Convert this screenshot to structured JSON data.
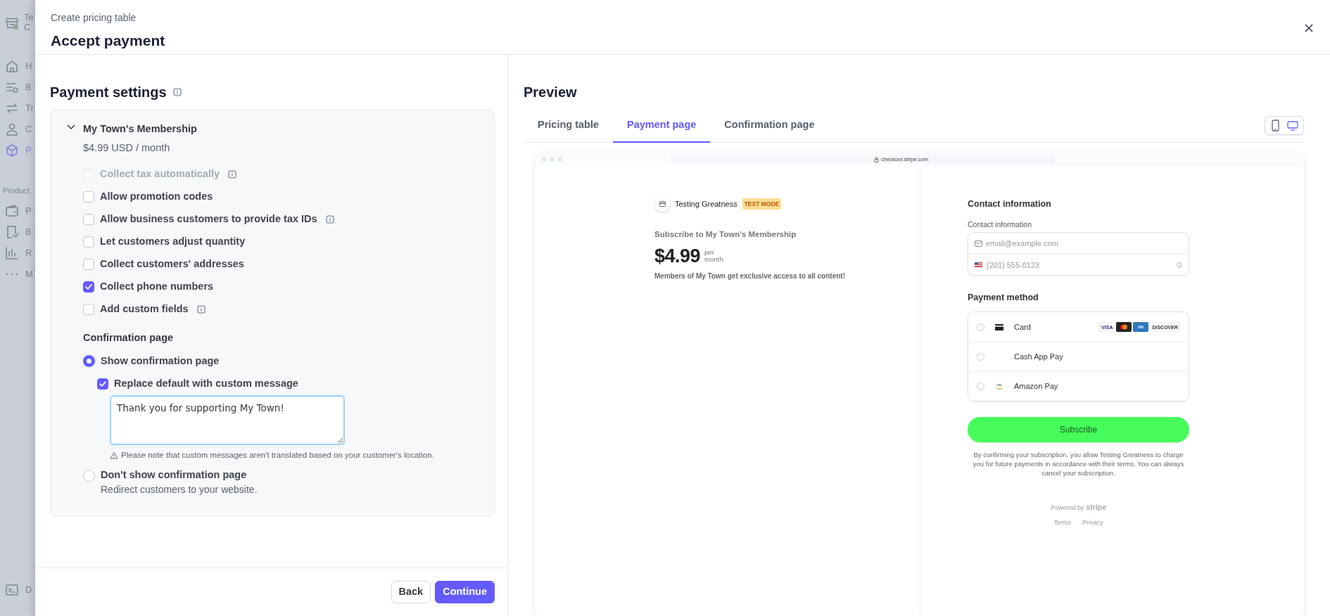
{
  "background_sidebar": {
    "account": [
      "Te",
      "C"
    ],
    "items": [
      {
        "label": "H",
        "selected": false
      },
      {
        "label": "B",
        "selected": false
      },
      {
        "label": "Tr",
        "selected": false
      },
      {
        "label": "C",
        "selected": false
      },
      {
        "label": "P",
        "selected": true
      }
    ],
    "section": "Product",
    "section_items": [
      {
        "label": "P"
      },
      {
        "label": "B"
      },
      {
        "label": "R"
      },
      {
        "label": "M"
      }
    ],
    "footer": "D"
  },
  "modal": {
    "subtitle": "Create pricing table",
    "title": "Accept payment"
  },
  "settings": {
    "title": "Payment settings",
    "product": {
      "name": "My Town's Membership",
      "price": "$4.99 USD / month",
      "expanded": true
    },
    "options": [
      {
        "label": "Collect tax automatically",
        "checked": false,
        "disabled": true,
        "info": true
      },
      {
        "label": "Allow promotion codes",
        "checked": false,
        "disabled": false,
        "info": false
      },
      {
        "label": "Allow business customers to provide tax IDs",
        "checked": false,
        "disabled": false,
        "info": true
      },
      {
        "label": "Let customers adjust quantity",
        "checked": false,
        "disabled": false,
        "info": false
      },
      {
        "label": "Collect customers' addresses",
        "checked": false,
        "disabled": false,
        "info": false
      },
      {
        "label": "Collect phone numbers",
        "checked": true,
        "disabled": false,
        "info": false
      },
      {
        "label": "Add custom fields",
        "checked": false,
        "disabled": false,
        "info": true
      }
    ],
    "confirmation": {
      "heading": "Confirmation page",
      "choices": [
        {
          "label": "Show confirmation page",
          "selected": true,
          "custom_message": {
            "label": "Replace default with custom message",
            "checked": true,
            "value": "Thank you for supporting My Town!",
            "note": "Please note that custom messages aren't translated based on your customer's location."
          }
        },
        {
          "label": "Don't show confirmation page",
          "selected": false,
          "description": "Redirect customers to your website."
        }
      ]
    }
  },
  "footer_buttons": [
    {
      "label": "Back",
      "kind": "secondary"
    },
    {
      "label": "Continue",
      "kind": "primary"
    }
  ],
  "preview": {
    "title": "Preview",
    "tabs": [
      {
        "label": "Pricing table",
        "selected": false
      },
      {
        "label": "Payment page",
        "selected": true
      },
      {
        "label": "Confirmation page",
        "selected": false
      }
    ],
    "devices": [
      {
        "kind": "phone",
        "selected": false
      },
      {
        "kind": "desktop",
        "selected": true
      }
    ],
    "checkout": {
      "url": "checkout.stripe.com",
      "merchant": "Testing Greatness",
      "badge": "TEST MODE",
      "heading": "Subscribe to My Town's Membership",
      "price": "$4.99",
      "interval": [
        "per",
        "month"
      ],
      "description": "Members of My Town get exclusive access to all content!",
      "contact": {
        "title": "Contact information",
        "label": "Contact information",
        "email_placeholder": "email@example.com",
        "phone_placeholder": "(201) 555-0123"
      },
      "payment": {
        "title": "Payment method",
        "methods": [
          {
            "label": "Card",
            "kind": "card",
            "selected": false
          },
          {
            "label": "Cash App Pay",
            "kind": "cashapp",
            "selected": false
          },
          {
            "label": "Amazon Pay",
            "kind": "amazon",
            "selected": false
          }
        ],
        "card_logos": [
          {
            "kind": "visa",
            "text": "VISA"
          },
          {
            "kind": "mastercard"
          },
          {
            "kind": "amex"
          },
          {
            "kind": "discover",
            "text": "DISCOVER"
          }
        ]
      },
      "button": "Subscribe",
      "terms": "By confirming your subscription, you allow Testing Greatness to charge you for future payments in accordance with their terms. You can always cancel your subscription.",
      "powered_by": "Powered by",
      "brand": "stripe",
      "links": [
        "Terms",
        "Privacy"
      ]
    }
  }
}
